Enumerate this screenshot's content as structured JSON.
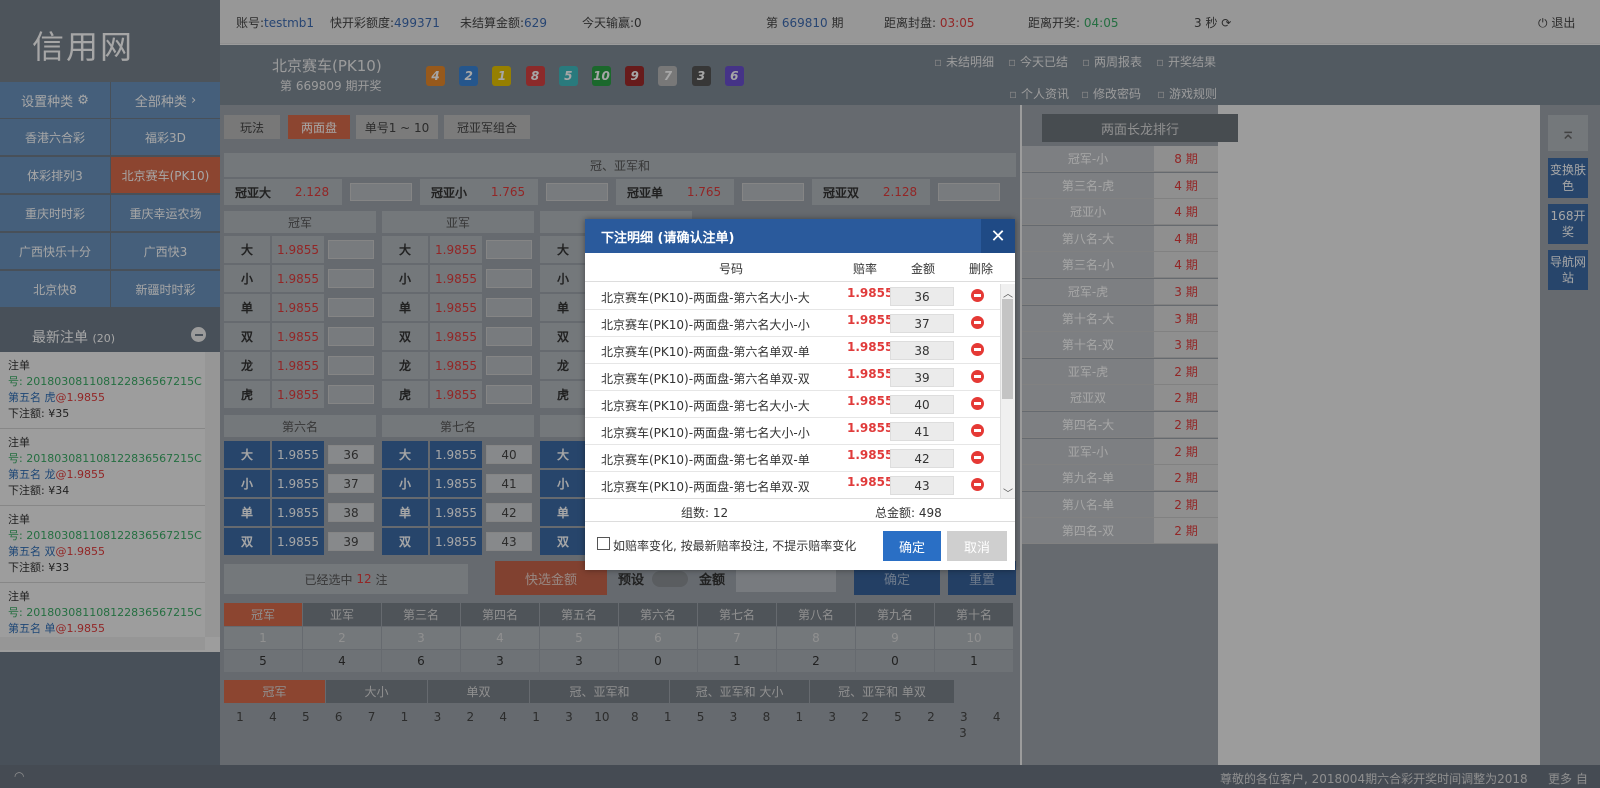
{
  "logo": "信用网",
  "sidebar": {
    "settings": "设置种类",
    "all": "全部种类",
    "lotteries": [
      "香港六合彩",
      "福彩3D",
      "体彩排列3",
      "北京赛车(PK10)",
      "重庆时时彩",
      "重庆幸运农场",
      "广西快乐十分",
      "广西快3",
      "北京快8",
      "新疆时时彩"
    ],
    "recent_title": "最新注单",
    "recent_count": "(20)",
    "orders": [
      {
        "label": "注单",
        "no": "号: 201803081108122836567215C",
        "pos": "第五名 虎",
        "odds": "@1.9855",
        "amount": "下注额: ¥35"
      },
      {
        "label": "注单",
        "no": "号: 201803081108122836567215C",
        "pos": "第五名 龙",
        "odds": "@1.9855",
        "amount": "下注额: ¥34"
      },
      {
        "label": "注单",
        "no": "号: 201803081108122836567215C",
        "pos": "第五名 双",
        "odds": "@1.9855",
        "amount": "下注额: ¥33"
      },
      {
        "label": "注单",
        "no": "号: 201803081108122836567215C",
        "pos": "第五名 单",
        "odds": "@1.9855",
        "amount": ""
      }
    ]
  },
  "topbar": {
    "account_label": "账号:",
    "account": "testmb1",
    "quota_label": "快开彩额度:",
    "quota": "499371",
    "unsettled_label": "未结算金额:",
    "unsettled": "629",
    "today_label": "今天输赢:",
    "today": "0",
    "period_prefix": "第",
    "period": "669810",
    "period_suffix": "期",
    "close_label": "距离封盘:",
    "close_time": "03:05",
    "open_label": "距离开奖:",
    "open_time": "04:05",
    "refresh": "3 秒",
    "logout": "退出"
  },
  "game": {
    "title": "北京赛车(PK10)",
    "draw": "第 669809 期开奖",
    "balls": [
      "4",
      "2",
      "1",
      "8",
      "5",
      "10",
      "9",
      "7",
      "3",
      "6"
    ],
    "ball_colors": [
      "#e8892a",
      "#3a85d8",
      "#e6c400",
      "#d84141",
      "#40bcc1",
      "#2aa044",
      "#9e2a2a",
      "#b8b8b8",
      "#555555",
      "#6a4fd0"
    ],
    "links": [
      "未结明细",
      "今天已结",
      "两周报表",
      "开奖结果",
      "个人资讯",
      "修改密码",
      "游戏规则"
    ]
  },
  "tabs": {
    "play": "玩法",
    "t1": "两面盘",
    "t2": "单号1 ~ 10",
    "t3": "冠亚军组合"
  },
  "champ_sum": {
    "title": "冠、亚军和",
    "items": [
      {
        "name": "冠亚大",
        "odds": "2.128"
      },
      {
        "name": "冠亚小",
        "odds": "1.765"
      },
      {
        "name": "冠亚单",
        "odds": "1.765"
      },
      {
        "name": "冠亚双",
        "odds": "2.128"
      }
    ]
  },
  "rank1": {
    "cols": [
      "冠军",
      "亚军"
    ],
    "rows": [
      {
        "k": "大",
        "o": "1.9855"
      },
      {
        "k": "小",
        "o": "1.9855"
      },
      {
        "k": "单",
        "o": "1.9855"
      },
      {
        "k": "双",
        "o": "1.9855"
      },
      {
        "k": "龙",
        "o": "1.9855"
      },
      {
        "k": "虎",
        "o": "1.9855"
      }
    ]
  },
  "rank2": {
    "cols": [
      "第六名",
      "第七名"
    ],
    "rows": [
      {
        "k": "大",
        "o": "1.9855",
        "a": "36",
        "a2": "40"
      },
      {
        "k": "小",
        "o": "1.9855",
        "a": "37",
        "a2": "41"
      },
      {
        "k": "单",
        "o": "1.9855",
        "a": "38",
        "a2": "42"
      },
      {
        "k": "双",
        "o": "1.9855",
        "a": "39",
        "a2": "43"
      }
    ]
  },
  "bet_bar": {
    "selected_pre": "已经选中",
    "selected_count": "12",
    "selected_suf": "注",
    "quick": "快选金额",
    "preset": "预设",
    "amount": "金额",
    "confirm": "确定",
    "reset": "重置"
  },
  "stats": {
    "headers": [
      "冠军",
      "亚军",
      "第三名",
      "第四名",
      "第五名",
      "第六名",
      "第七名",
      "第八名",
      "第九名",
      "第十名"
    ],
    "nums": [
      "1",
      "2",
      "3",
      "4",
      "5",
      "6",
      "7",
      "8",
      "9",
      "10"
    ],
    "counts": [
      "5",
      "4",
      "6",
      "3",
      "3",
      "0",
      "1",
      "2",
      "0",
      "1"
    ]
  },
  "trend": {
    "tabs": [
      "冠军",
      "大小",
      "单双",
      "冠、亚军和",
      "冠、亚军和 大小",
      "冠、亚军和 单双"
    ],
    "values": [
      "1",
      "4",
      "5",
      "6",
      "7",
      "1",
      "3",
      "2",
      "4",
      "1",
      "3",
      "10",
      "8",
      "1",
      "5",
      "3",
      "8",
      "1",
      "3",
      "2",
      "5",
      "2",
      "3",
      "4"
    ],
    "extra": "3"
  },
  "dragon": {
    "title": "两面长龙排行",
    "rows": [
      {
        "n": "冠军-小",
        "p": "8 期"
      },
      {
        "n": "第三名-虎",
        "p": "4 期"
      },
      {
        "n": "冠亚小",
        "p": "4 期"
      },
      {
        "n": "第八名-大",
        "p": "4 期"
      },
      {
        "n": "第三名-小",
        "p": "4 期"
      },
      {
        "n": "冠军-虎",
        "p": "3 期"
      },
      {
        "n": "第十名-大",
        "p": "3 期"
      },
      {
        "n": "第十名-双",
        "p": "3 期"
      },
      {
        "n": "亚军-虎",
        "p": "2 期"
      },
      {
        "n": "冠亚双",
        "p": "2 期"
      },
      {
        "n": "第四名-大",
        "p": "2 期"
      },
      {
        "n": "亚军-小",
        "p": "2 期"
      },
      {
        "n": "第九名-单",
        "p": "2 期"
      },
      {
        "n": "第八名-单",
        "p": "2 期"
      },
      {
        "n": "第四名-双",
        "p": "2 期"
      }
    ]
  },
  "rightnav": [
    "变换肤色",
    "168开奖",
    "导航网站"
  ],
  "modal": {
    "title": "下注明细 (请确认注单)",
    "col_no": "号码",
    "col_odds": "赔率",
    "col_amt": "金额",
    "col_del": "删除",
    "rows": [
      {
        "n": "北京赛车(PK10)-两面盘-第六名大小-大",
        "o": "1.9855",
        "a": "36"
      },
      {
        "n": "北京赛车(PK10)-两面盘-第六名大小-小",
        "o": "1.9855",
        "a": "37"
      },
      {
        "n": "北京赛车(PK10)-两面盘-第六名单双-单",
        "o": "1.9855",
        "a": "38"
      },
      {
        "n": "北京赛车(PK10)-两面盘-第六名单双-双",
        "o": "1.9855",
        "a": "39"
      },
      {
        "n": "北京赛车(PK10)-两面盘-第七名大小-大",
        "o": "1.9855",
        "a": "40"
      },
      {
        "n": "北京赛车(PK10)-两面盘-第七名大小-小",
        "o": "1.9855",
        "a": "41"
      },
      {
        "n": "北京赛车(PK10)-两面盘-第七名单双-单",
        "o": "1.9855",
        "a": "42"
      },
      {
        "n": "北京赛车(PK10)-两面盘-第七名单双-双",
        "o": "1.9855",
        "a": "43"
      }
    ],
    "count_label": "组数:",
    "count": "12",
    "total_label": "总金额:",
    "total": "498",
    "checkbox_label": "如赔率变化, 按最新赔率投注, 不提示赔率变化",
    "ok": "确定",
    "cancel": "取消"
  },
  "bottom": {
    "notice": "尊敬的各位客户, 2018004期六合彩开奖时间调整为2018",
    "more": "更多 自"
  }
}
